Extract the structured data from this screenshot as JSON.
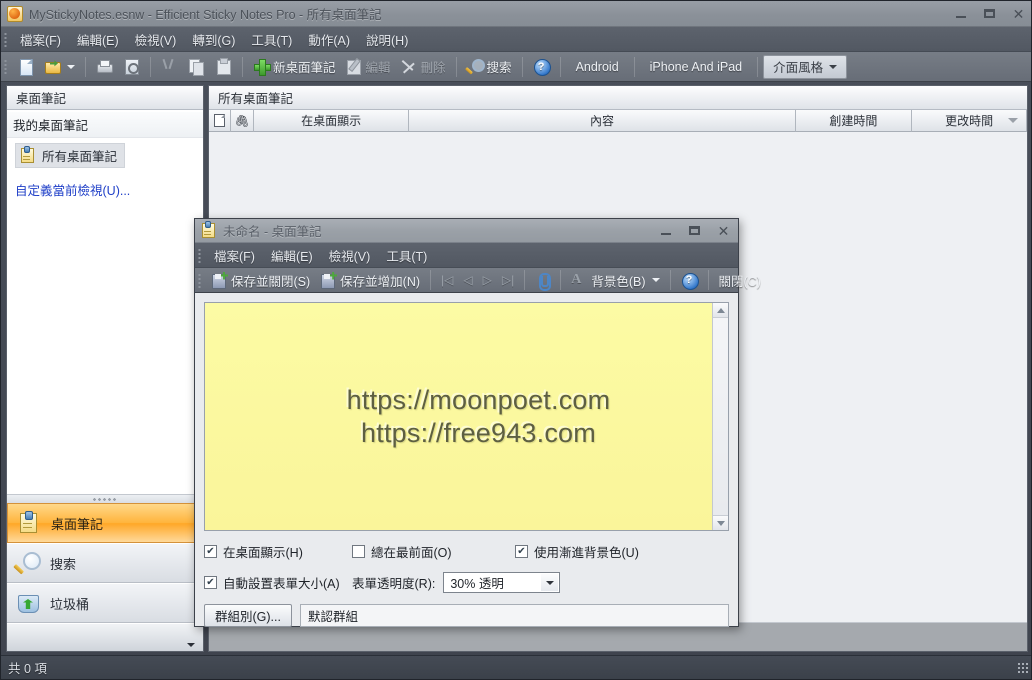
{
  "window": {
    "title": "MyStickyNotes.esnw - Efficient Sticky Notes Pro - 所有桌面筆記",
    "app_icon": "sticky-note-app-icon",
    "minimize": "–",
    "maximize": "□",
    "close": "✕"
  },
  "menubar": {
    "items": [
      {
        "label": "檔案(F)"
      },
      {
        "label": "編輯(E)"
      },
      {
        "label": "檢視(V)"
      },
      {
        "label": "轉到(G)"
      },
      {
        "label": "工具(T)"
      },
      {
        "label": "動作(A)"
      },
      {
        "label": "說明(H)"
      }
    ]
  },
  "toolbar": {
    "new_doc": "",
    "open": "",
    "print": "",
    "preview": "",
    "cut": "",
    "copy": "",
    "paste": "",
    "new_note": "新桌面筆記",
    "edit": "編輯",
    "delete": "刪除",
    "search": "搜索",
    "help": "",
    "android": "Android",
    "iphone_ipad": "iPhone And iPad",
    "ui_style": "介面風格"
  },
  "sidebar": {
    "header": "桌面筆記",
    "tree_root": "我的桌面筆記",
    "tree_node": "所有桌面筆記",
    "customize_link": "自定義當前檢視(U)...",
    "nav_items": [
      {
        "label": "桌面筆記",
        "icon": "sticky-note-icon",
        "selected": true
      },
      {
        "label": "搜索",
        "icon": "magnifier-icon",
        "selected": false
      },
      {
        "label": "垃圾桶",
        "icon": "recycle-bin-icon",
        "selected": false
      }
    ]
  },
  "list_panel": {
    "title": "所有桌面筆記",
    "columns": [
      {
        "label": "",
        "icon": "page-icon"
      },
      {
        "label": "",
        "icon": "paperclip-icon"
      },
      {
        "label": "在桌面顯示"
      },
      {
        "label": "內容"
      },
      {
        "label": "創建時間"
      },
      {
        "label": "更改時間",
        "sorted": true
      }
    ],
    "rows": []
  },
  "dialog": {
    "title": "未命名 - 桌面筆記",
    "icon": "sticky-note-icon",
    "minimize": "–",
    "maximize": "□",
    "close": "✕",
    "menubar": [
      {
        "label": "檔案(F)"
      },
      {
        "label": "編輯(E)"
      },
      {
        "label": "檢視(V)"
      },
      {
        "label": "工具(T)"
      }
    ],
    "toolbar": {
      "save_close": "保存並關閉(S)",
      "save_new": "保存並增加(N)",
      "nav_first": "|◁",
      "nav_prev": "◁",
      "nav_next": "▷",
      "nav_last": "▷|",
      "attach": "",
      "font": "A",
      "bg_color": "背景色(B)",
      "help": "",
      "close": "關閉(C)"
    },
    "note": {
      "background_color": "#fbfaa0",
      "lines": [
        "https://moonpoet.com",
        "https://free943.com"
      ]
    },
    "options": {
      "show_on_desktop": {
        "label": "在桌面顯示(H)",
        "checked": true
      },
      "always_on_top": {
        "label": "總在最前面(O)",
        "checked": false
      },
      "use_gradient_bg": {
        "label": "使用漸進背景色(U)",
        "checked": true
      },
      "auto_size": {
        "label": "自動設置表單大小(A)",
        "checked": true
      },
      "transparency_label": "表單透明度(R):",
      "transparency_value": "30% 透明",
      "group_button": "群組別(G)...",
      "group_value": "默認群組"
    }
  },
  "statusbar": {
    "text": "共 0 項"
  },
  "colors": {
    "accent_orange": "#ffa726",
    "note_yellow": "#fbfaa0",
    "link_blue": "#2040c8",
    "chrome_dark": "#3f444e"
  }
}
